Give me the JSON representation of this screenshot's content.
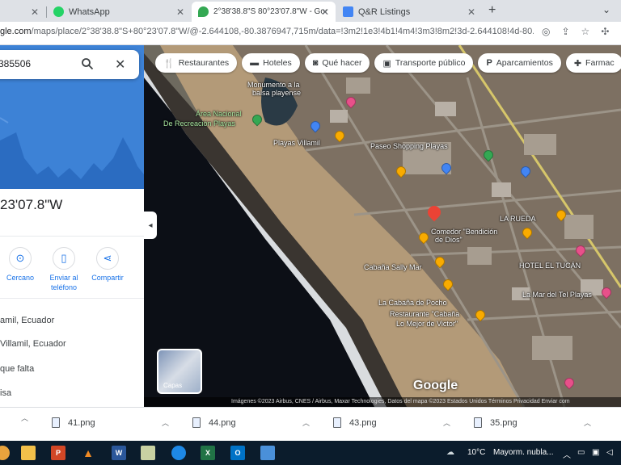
{
  "browser": {
    "tabs": [
      {
        "label": "",
        "active": false
      },
      {
        "label": "WhatsApp",
        "active": false
      },
      {
        "label": "2°38'38.8\"S 80°23'07.8\"W - Goo",
        "active": true
      },
      {
        "label": "Q&R Listings",
        "active": false
      }
    ],
    "url_host": "gle.com",
    "url_path": "/maps/place/2°38'38.8\"S+80°23'07.8\"W/@-2.644108,-80.3876947,715m/data=!3m2!1e3!4b1!4m4!3m3!8m2!3d-2.644108!4d-80.385506"
  },
  "sidebar": {
    "search_value": "385506",
    "coords_title": "23'07.8\"W",
    "actions": [
      {
        "label": "Cercano",
        "icon": "nearby-icon"
      },
      {
        "label": "Enviar al teléfono",
        "icon": "phone-icon"
      },
      {
        "label": "Compartir",
        "icon": "share-icon"
      }
    ],
    "info": [
      "amil, Ecuador",
      "Villamil, Ecuador",
      "que falta",
      "isa"
    ]
  },
  "map": {
    "chips": [
      {
        "label": "Restaurantes",
        "icon": "fork-knife-icon"
      },
      {
        "label": "Hoteles",
        "icon": "bed-icon"
      },
      {
        "label": "Qué hacer",
        "icon": "camera-icon"
      },
      {
        "label": "Transporte público",
        "icon": "transit-icon"
      },
      {
        "label": "Aparcamientos",
        "icon": "parking-icon"
      },
      {
        "label": "Farmac",
        "icon": "pharmacy-icon"
      }
    ],
    "labels": [
      "Monumento a la",
      "balsa playense",
      "Área Nacional",
      "De Recreación Playas",
      "Playas Villamil",
      "Paseo Shopping Playas",
      "Comedor \"Bendición",
      "de Dios\"",
      "Cabaña Sally Mar",
      "La Cabaña de Pocho",
      "Restaurante \"Cabaña",
      "Lo Mejor de Victor\"",
      "LA RUEDA",
      "HOTEL EL TUCÁN",
      "La Mar del Tel Playas"
    ],
    "layers_label": "Capas",
    "google_logo": "Google",
    "attribution": "Imágenes ©2023 Airbus, CNES / Airbus, Maxar Technologies, Datos del mapa ©2023    Estados Unidos    Términos    Privacidad    Enviar com"
  },
  "downloads": [
    "",
    "41.png",
    "44.png",
    "43.png",
    "35.png"
  ],
  "taskbar": {
    "temperature": "10°C",
    "weather": "Mayorm. nubla..."
  }
}
